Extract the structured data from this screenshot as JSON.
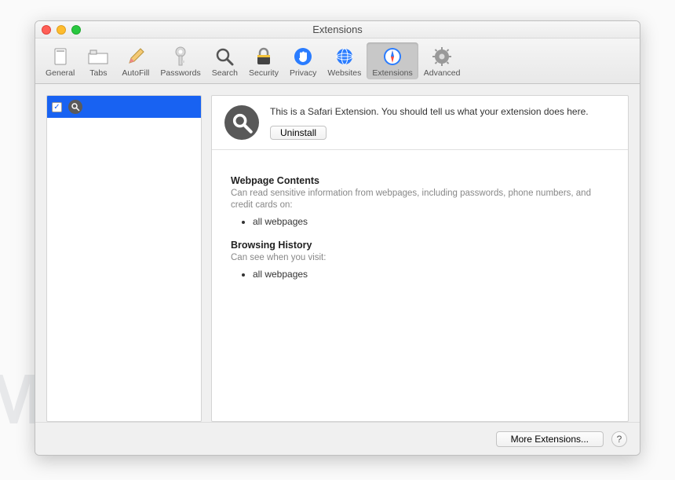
{
  "watermark": "MALWARETIPS",
  "window": {
    "title": "Extensions"
  },
  "toolbar": {
    "items": [
      {
        "label": "General"
      },
      {
        "label": "Tabs"
      },
      {
        "label": "AutoFill"
      },
      {
        "label": "Passwords"
      },
      {
        "label": "Search"
      },
      {
        "label": "Security"
      },
      {
        "label": "Privacy"
      },
      {
        "label": "Websites"
      },
      {
        "label": "Extensions"
      },
      {
        "label": "Advanced"
      }
    ],
    "active_index": 8
  },
  "sidebar": {
    "items": [
      {
        "checked": true,
        "icon": "search-icon"
      }
    ]
  },
  "main": {
    "description": "This is a Safari Extension. You should tell us what your extension does here.",
    "uninstall_label": "Uninstall",
    "permissions": [
      {
        "title": "Webpage Contents",
        "subtitle": "Can read sensitive information from webpages, including passwords, phone numbers, and credit cards on:",
        "items": [
          "all webpages"
        ]
      },
      {
        "title": "Browsing History",
        "subtitle": "Can see when you visit:",
        "items": [
          "all webpages"
        ]
      }
    ]
  },
  "footer": {
    "more_label": "More Extensions...",
    "help_label": "?"
  }
}
